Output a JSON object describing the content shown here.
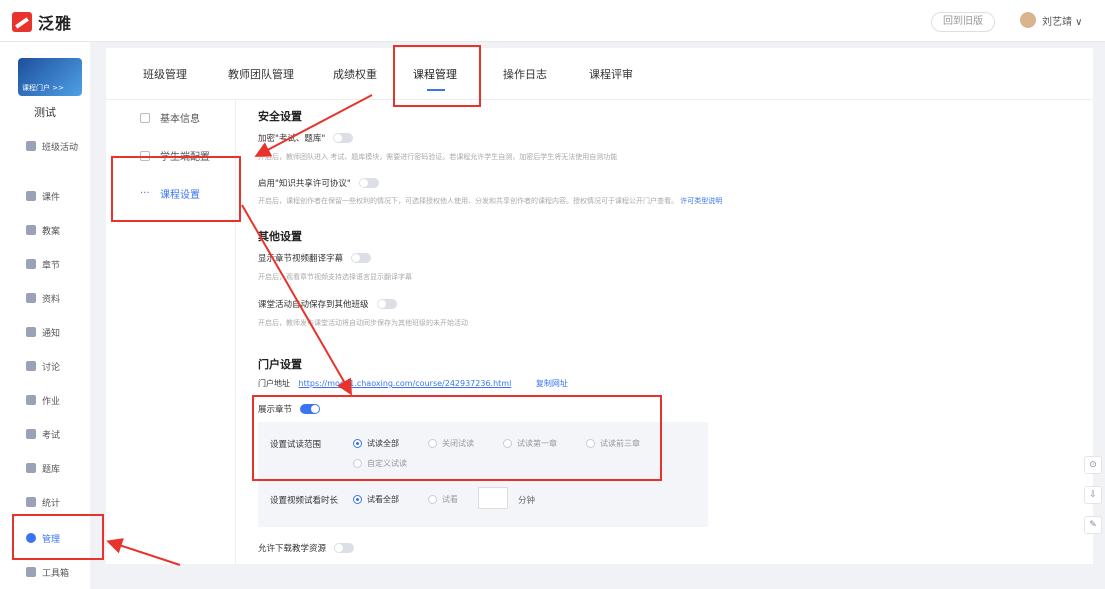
{
  "header": {
    "logo_text": "泛雅",
    "back_label": "回到旧版",
    "user_name": "刘艺靖 ∨"
  },
  "sidebar": {
    "cover_text": "课程门户 >>",
    "course_name": "测试",
    "items": [
      {
        "label": "班级活动",
        "icon": "grid-icon"
      },
      {
        "label": "课件",
        "icon": "file-icon"
      },
      {
        "label": "教案",
        "icon": "doc-icon"
      },
      {
        "label": "章节",
        "icon": "list-icon"
      },
      {
        "label": "资料",
        "icon": "folder-icon"
      },
      {
        "label": "通知",
        "icon": "speaker-icon"
      },
      {
        "label": "讨论",
        "icon": "chat-icon"
      },
      {
        "label": "作业",
        "icon": "edit-icon"
      },
      {
        "label": "考试",
        "icon": "exam-icon"
      },
      {
        "label": "题库",
        "icon": "stack-icon"
      },
      {
        "label": "统计",
        "icon": "pie-icon"
      },
      {
        "label": "管理",
        "icon": "gear-icon",
        "active": true
      },
      {
        "label": "工具箱",
        "icon": "toolbox-icon"
      }
    ]
  },
  "tabs": [
    {
      "label": "班级管理"
    },
    {
      "label": "教师团队管理"
    },
    {
      "label": "成绩权重"
    },
    {
      "label": "课程管理",
      "active": true
    },
    {
      "label": "操作日志"
    },
    {
      "label": "课程评审"
    }
  ],
  "subnav": [
    {
      "label": "基本信息"
    },
    {
      "label": "学生端配置"
    },
    {
      "label": "课程设置",
      "active": true
    }
  ],
  "security": {
    "title": "安全设置",
    "encrypt_label": "加密\"考试、题库\"",
    "encrypt_hint": "开启后，教师团队进入 考试、题库模块，需要进行密码验证。若课程允许学生自测，加密后学生将无法使用自测功能",
    "license_label": "启用\"知识共享许可协议\"",
    "license_hint": "开启后，课程创作者在保留一些权利的情况下，可选择授权他人使用、分发和共享创作者的课程内容。授权情况可于课程公开门户查看。",
    "license_link": "许可类型说明"
  },
  "other": {
    "title": "其他设置",
    "subtitle_label": "显示章节视频翻译字幕",
    "subtitle_hint": "开启后，观看章节视频支持选择语言显示翻译字幕",
    "save_label": "课堂活动自动保存到其他班级",
    "save_hint": "开启后，教师发布课堂活动将自动同步保存为其他班级的未开始活动"
  },
  "portal": {
    "title": "门户设置",
    "url_label": "门户地址",
    "url": "https://mooc1.chaoxing.com/course/242937236.html",
    "copy_label": "复制网址",
    "show_chapters_label": "展示章节",
    "trial_range_label": "设置试读范围",
    "trial_options": [
      "试读全部",
      "关闭试读",
      "试读第一章",
      "试读前三章",
      "自定义试读"
    ],
    "trial_selected": "试读全部",
    "video_label": "设置视频试看时长",
    "video_options": [
      "试看全部",
      "试看"
    ],
    "video_selected": "试看全部",
    "minute_unit": "分钟",
    "download_label": "允许下载教学资源"
  },
  "colors": {
    "accent": "#3a74f2",
    "annotation": "#e8332c"
  }
}
